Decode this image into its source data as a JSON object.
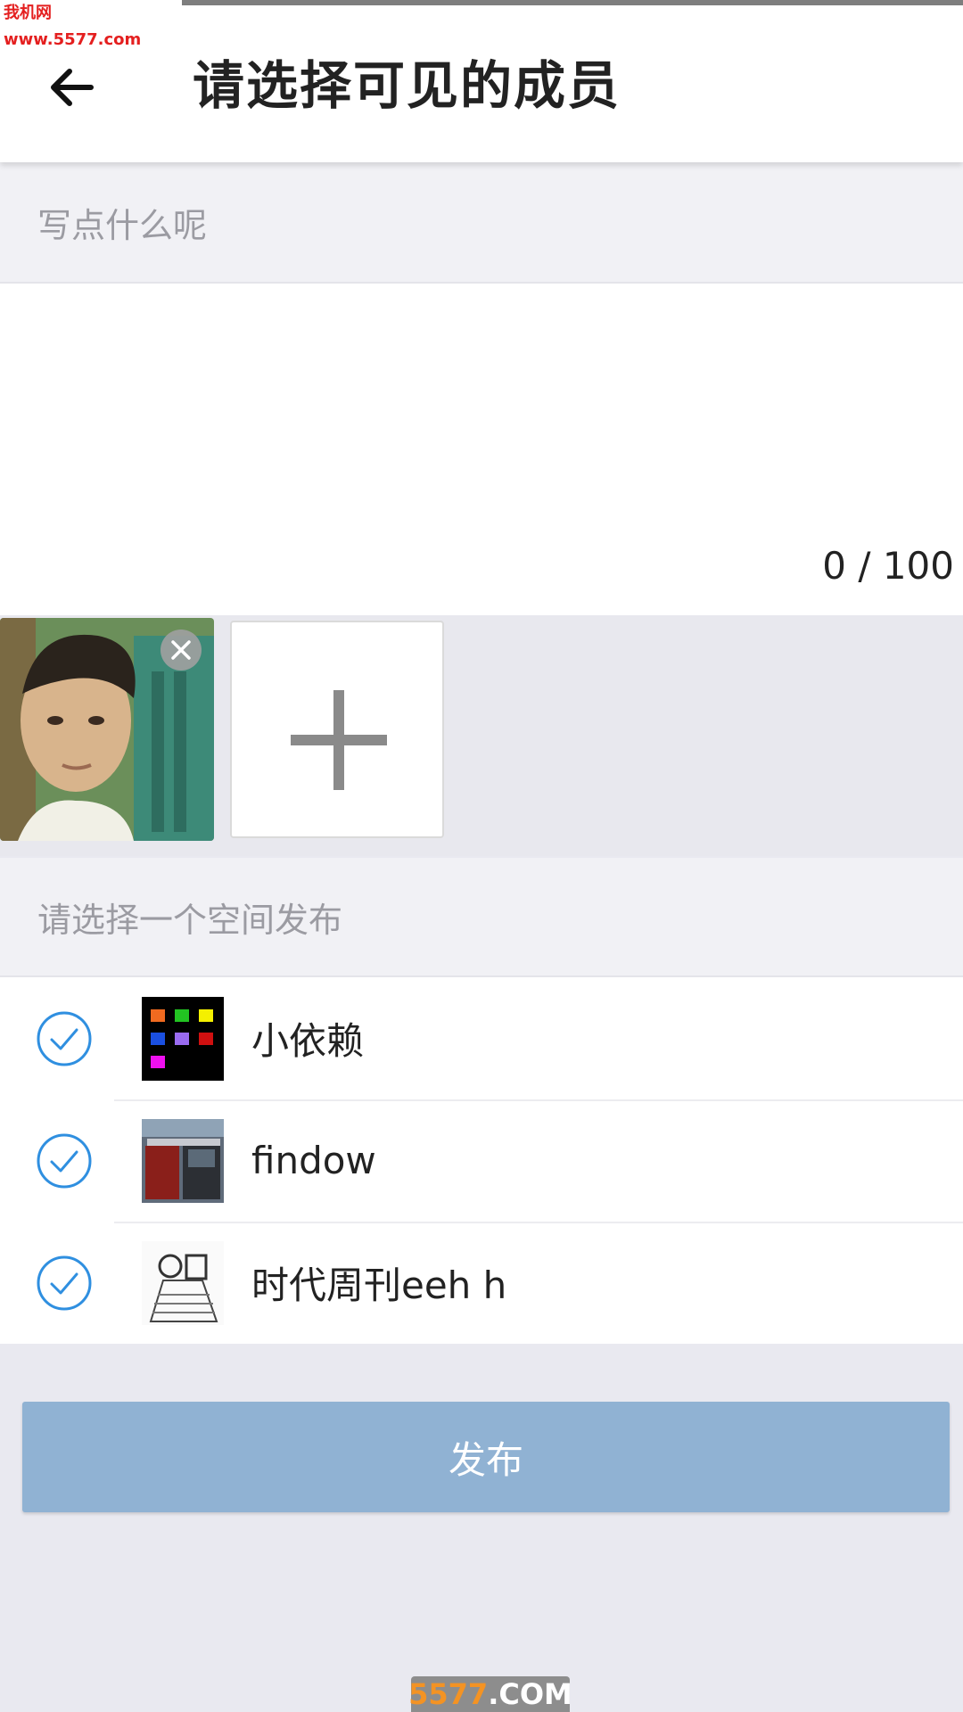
{
  "watermark": {
    "top_text": "我机网 www.5577.com",
    "bottom_num": "5577",
    "bottom_suffix": ".COM"
  },
  "appbar": {
    "title": "请选择可见的成员",
    "back_icon": "arrow-left"
  },
  "compose": {
    "placeholder": "写点什么呢",
    "counter": "0 / 100"
  },
  "images": {
    "delete_icon": "close-x",
    "add_icon": "plus"
  },
  "spaces": {
    "header": "请选择一个空间发布",
    "items": [
      {
        "name": "小依赖",
        "checked": true
      },
      {
        "name": "findow",
        "checked": true
      },
      {
        "name": "时代周刊eeh h",
        "checked": true
      }
    ]
  },
  "publish_button": {
    "label": "发布"
  },
  "colors": {
    "accent_blue": "#2f8fe0",
    "publish_bg": "#90b2d3",
    "page_bg": "#e9e9f0"
  }
}
